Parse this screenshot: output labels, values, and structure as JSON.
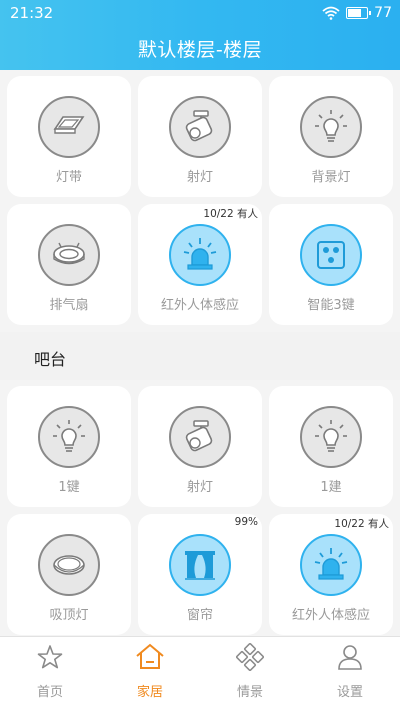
{
  "status": {
    "time": "21:32",
    "battery": "77",
    "battery_level": 0.77
  },
  "header": {
    "title": "默认楼层-楼层"
  },
  "section1": {
    "items": [
      {
        "label": "灯带",
        "icon": "downlight-icon",
        "state": "off",
        "badge": ""
      },
      {
        "label": "射灯",
        "icon": "spotlight-icon",
        "state": "off",
        "badge": ""
      },
      {
        "label": "背景灯",
        "icon": "bulb-icon",
        "state": "off",
        "badge": ""
      },
      {
        "label": "排气扇",
        "icon": "exhaust-fan-icon",
        "state": "off",
        "badge": ""
      },
      {
        "label": "红外人体感应",
        "icon": "alarm-light-icon",
        "state": "on",
        "badge": "10/22 有人"
      },
      {
        "label": "智能3键",
        "icon": "switch-3key-icon",
        "state": "on",
        "badge": ""
      }
    ]
  },
  "section2": {
    "title": "吧台",
    "items": [
      {
        "label": "1键",
        "icon": "bulb-icon",
        "state": "off",
        "badge": ""
      },
      {
        "label": "射灯",
        "icon": "spotlight-icon",
        "state": "off",
        "badge": ""
      },
      {
        "label": "1建",
        "icon": "bulb-icon",
        "state": "off",
        "badge": ""
      },
      {
        "label": "吸顶灯",
        "icon": "ceiling-light-icon",
        "state": "off",
        "badge": ""
      },
      {
        "label": "窗帘",
        "icon": "curtain-icon",
        "state": "on",
        "badge": "99%"
      },
      {
        "label": "红外人体感应",
        "icon": "alarm-light-icon",
        "state": "on",
        "badge": "10/22 有人"
      }
    ]
  },
  "tabs": [
    {
      "label": "首页",
      "icon": "star-icon",
      "active": false
    },
    {
      "label": "家居",
      "icon": "home-icon",
      "active": true
    },
    {
      "label": "情景",
      "icon": "scene-icon",
      "active": false
    },
    {
      "label": "设置",
      "icon": "person-icon",
      "active": false
    }
  ],
  "colors": {
    "accent": "#2fb2ee",
    "tab_active": "#f08a1f",
    "header": "#33b8f1"
  }
}
